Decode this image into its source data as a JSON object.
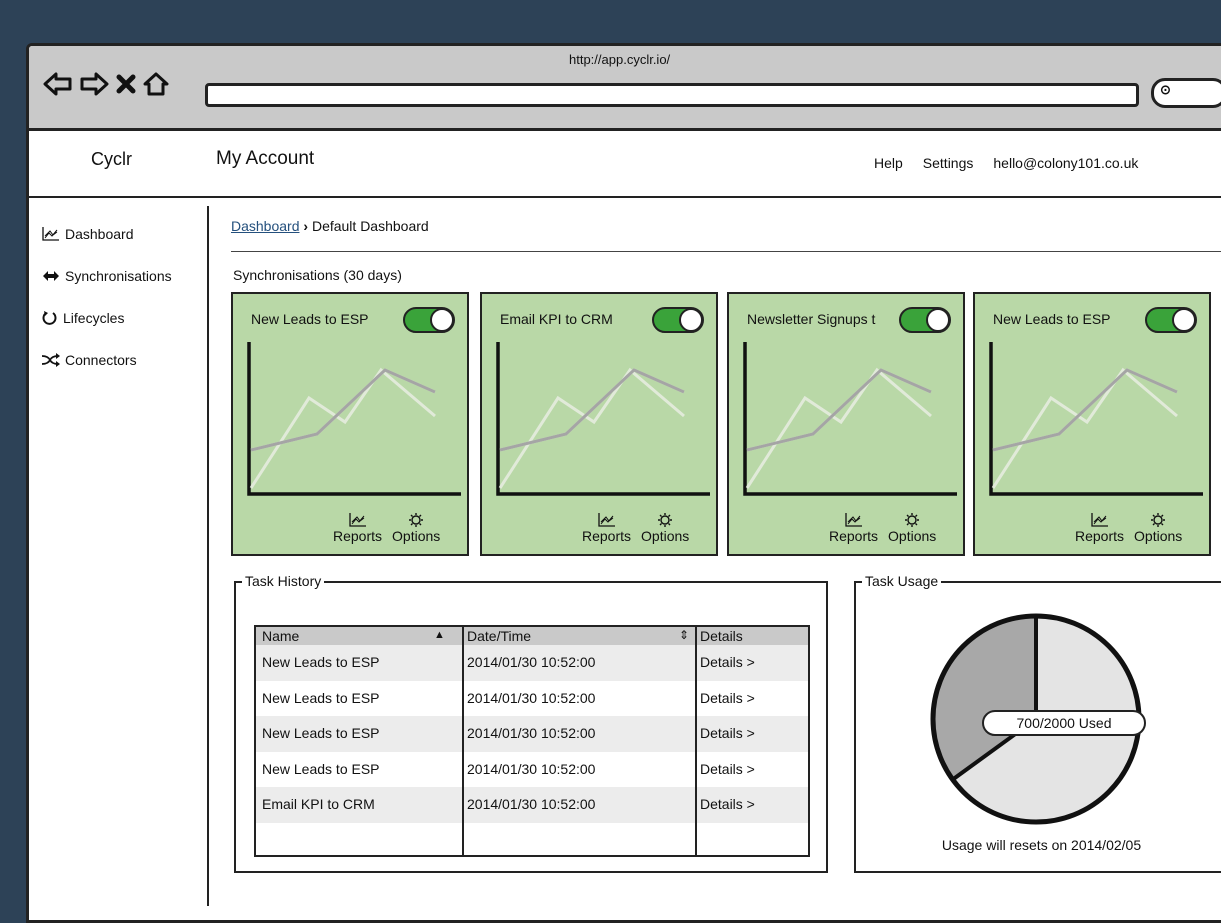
{
  "browser": {
    "url": "http://app.cyclr.io/"
  },
  "header": {
    "brand": "Cyclr",
    "title": "My Account",
    "nav": [
      "Help",
      "Settings",
      "hello@colony101.co.uk"
    ]
  },
  "sidebar": {
    "items": [
      {
        "label": "Dashboard",
        "icon": "chart-icon"
      },
      {
        "label": "Synchronisations",
        "icon": "sync-arrows-icon"
      },
      {
        "label": "Lifecycles",
        "icon": "cycle-icon"
      },
      {
        "label": "Connectors",
        "icon": "shuffle-icon"
      }
    ]
  },
  "breadcrumb": {
    "link": "Dashboard",
    "current": "Default Dashboard"
  },
  "sync_section_label": "Synchronisations (30 days)",
  "cards": [
    {
      "title": "New Leads to ESP",
      "enabled": true,
      "reports": "Reports",
      "options": "Options"
    },
    {
      "title": "Email KPI to CRM",
      "enabled": true,
      "reports": "Reports",
      "options": "Options"
    },
    {
      "title": "Newsletter Signups t",
      "enabled": true,
      "reports": "Reports",
      "options": "Options"
    },
    {
      "title": "New Leads to ESP",
      "enabled": true,
      "reports": "Reports",
      "options": "Options"
    }
  ],
  "task_history": {
    "legend": "Task History",
    "columns": [
      "Name",
      "Date/Time",
      "Details"
    ],
    "rows": [
      [
        "New Leads to ESP",
        "2014/01/30 10:52:00",
        "Details >"
      ],
      [
        "New Leads to ESP",
        "2014/01/30 10:52:00",
        "Details >"
      ],
      [
        "New Leads to ESP",
        "2014/01/30 10:52:00",
        "Details >"
      ],
      [
        "New Leads to ESP",
        "2014/01/30 10:52:00",
        "Details >"
      ],
      [
        "Email KPI to CRM",
        "2014/01/30 10:52:00",
        "Details >"
      ]
    ]
  },
  "task_usage": {
    "legend": "Task Usage",
    "used": 700,
    "total": 2000,
    "label": "700/2000 Used",
    "note": "Usage will resets on 2014/02/05",
    "colors": {
      "used": "#a8a8a8",
      "free": "#e4e4e4"
    }
  },
  "colors": {
    "card_bg": "#b9d8a7",
    "toggle_on": "#3aa33a",
    "page_bg": "#2d4257"
  }
}
